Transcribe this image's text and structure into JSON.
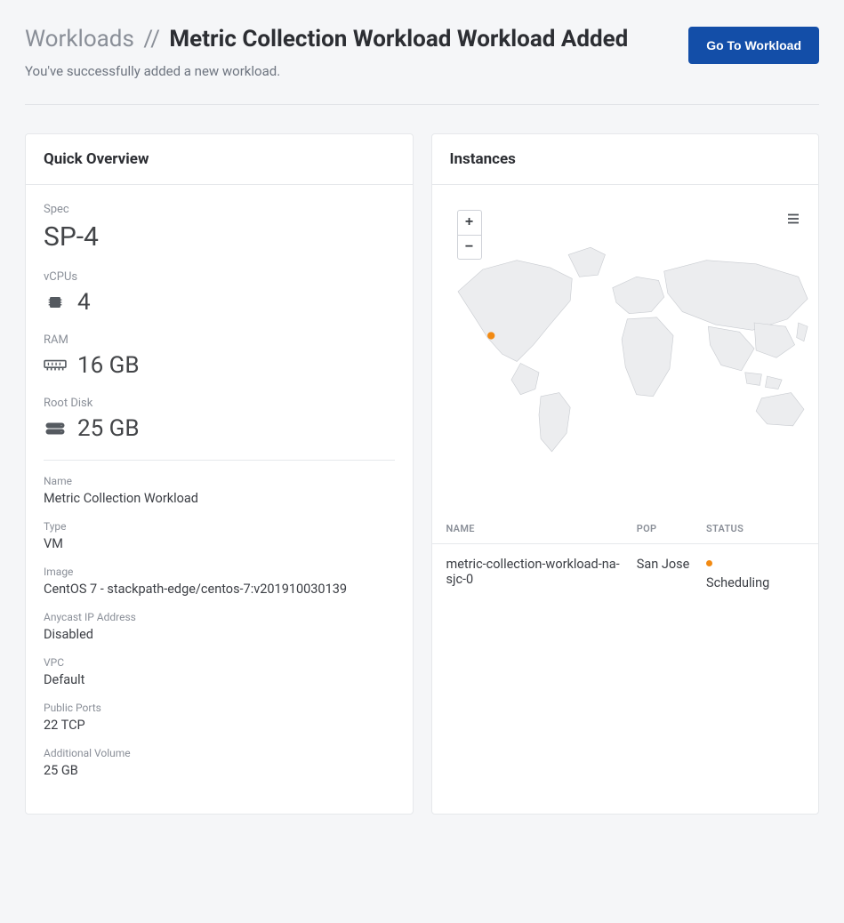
{
  "header": {
    "breadcrumb_root": "Workloads",
    "breadcrumb_sep": "//",
    "title": "Metric Collection Workload Workload Added",
    "subtitle": "You've successfully added a new workload.",
    "go_button": "Go To Workload"
  },
  "overview": {
    "card_title": "Quick Overview",
    "spec_label": "Spec",
    "spec_value": "SP-4",
    "vcpu_label": "vCPUs",
    "vcpu_value": "4",
    "ram_label": "RAM",
    "ram_value": "16 GB",
    "disk_label": "Root Disk",
    "disk_value": "25 GB",
    "details": [
      {
        "label": "Name",
        "value": "Metric Collection Workload"
      },
      {
        "label": "Type",
        "value": "VM"
      },
      {
        "label": "Image",
        "value": "CentOS 7 - stackpath-edge/centos-7:v201910030139"
      },
      {
        "label": "Anycast IP Address",
        "value": "Disabled"
      },
      {
        "label": "VPC",
        "value": "Default"
      },
      {
        "label": "Public Ports",
        "value": "22 TCP"
      },
      {
        "label": "Additional Volume",
        "value": "25 GB"
      }
    ]
  },
  "instances": {
    "card_title": "Instances",
    "zoom_in": "+",
    "zoom_out": "−",
    "columns": {
      "name": "NAME",
      "pop": "POP",
      "status": "STATUS"
    },
    "rows": [
      {
        "name": "metric-collection-workload-na-sjc-0",
        "pop": "San Jose",
        "status": "Scheduling",
        "status_color": "scheduling"
      }
    ]
  }
}
